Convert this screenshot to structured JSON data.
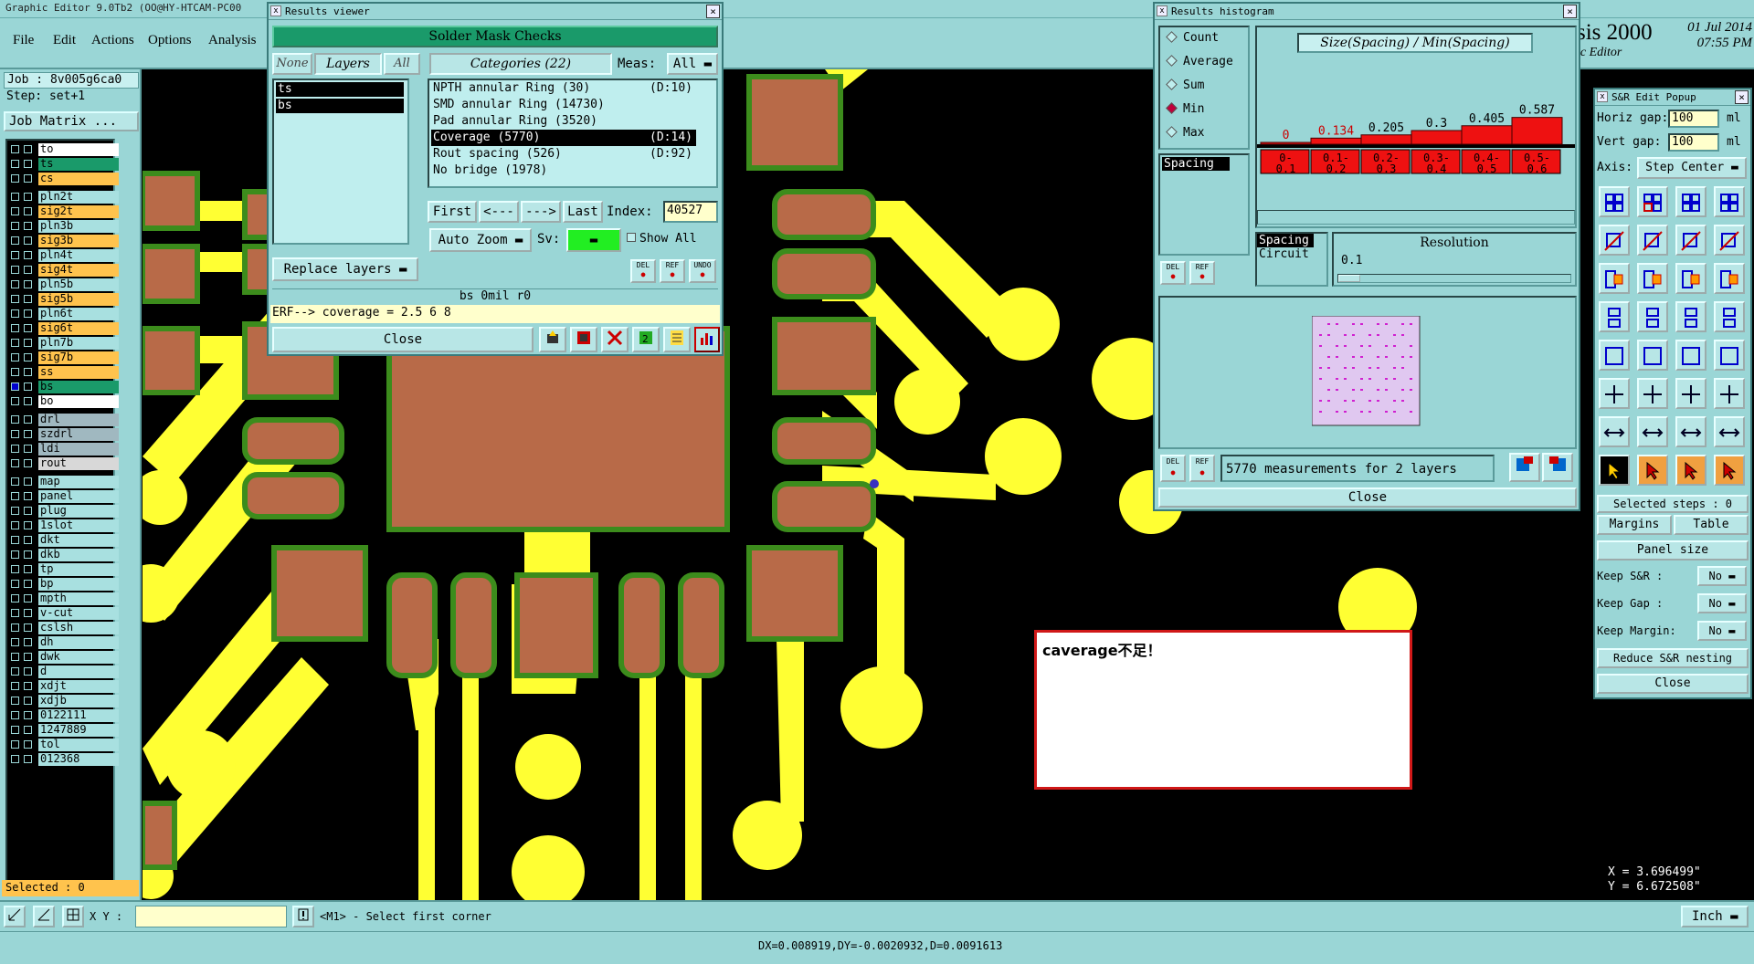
{
  "window": {
    "title": "Graphic Editor 9.0Tb2  (OO@HY-HTCAM-PC00"
  },
  "menu": {
    "items": [
      "File",
      "Edit",
      "Actions",
      "Options",
      "Analysis"
    ]
  },
  "brand": {
    "name": "sis 2000",
    "subtitle": "ic Editor",
    "date": "01 Jul 2014",
    "time": "07:55 PM"
  },
  "left": {
    "job": "Job : 8v005g6ca0",
    "step": "Step: set+1",
    "job_matrix": "Job Matrix ...",
    "selected": "Selected : 0",
    "layers": [
      {
        "name": "to",
        "color": "#ffffff",
        "checked": false
      },
      {
        "name": "ts",
        "color": "#1a9a6a",
        "checked": false
      },
      {
        "name": "cs",
        "color": "#ffc34d",
        "checked": false
      },
      {
        "name": "pln2t",
        "color": "#a8e0e0",
        "checked": false
      },
      {
        "name": "sig2t",
        "color": "#ffc34d",
        "checked": false
      },
      {
        "name": "pln3b",
        "color": "#a8e0e0",
        "checked": false
      },
      {
        "name": "sig3b",
        "color": "#ffc34d",
        "checked": false
      },
      {
        "name": "pln4t",
        "color": "#a8e0e0",
        "checked": false
      },
      {
        "name": "sig4t",
        "color": "#ffc34d",
        "checked": false
      },
      {
        "name": "pln5b",
        "color": "#a8e0e0",
        "checked": false
      },
      {
        "name": "sig5b",
        "color": "#ffc34d",
        "checked": false
      },
      {
        "name": "pln6t",
        "color": "#a8e0e0",
        "checked": false
      },
      {
        "name": "sig6t",
        "color": "#ffc34d",
        "checked": false
      },
      {
        "name": "pln7b",
        "color": "#a8e0e0",
        "checked": false
      },
      {
        "name": "sig7b",
        "color": "#ffc34d",
        "checked": false
      },
      {
        "name": "ss",
        "color": "#ffc34d",
        "checked": false
      },
      {
        "name": "bs",
        "color": "#1a9a6a",
        "checked": true
      },
      {
        "name": "bo",
        "color": "#ffffff",
        "checked": false
      },
      {
        "name": "drl",
        "color": "#a0b8c0",
        "checked": false
      },
      {
        "name": "szdrl",
        "color": "#a0b8c0",
        "checked": false
      },
      {
        "name": "ldi",
        "color": "#a0b8c0",
        "checked": false
      },
      {
        "name": "rout",
        "color": "#d8d8d8",
        "checked": false
      },
      {
        "name": "map",
        "color": "#a8e0e0",
        "checked": false
      },
      {
        "name": "panel",
        "color": "#a8e0e0",
        "checked": false
      },
      {
        "name": "plug",
        "color": "#a8e0e0",
        "checked": false
      },
      {
        "name": "1slot",
        "color": "#a8e0e0",
        "checked": false
      },
      {
        "name": "dkt",
        "color": "#a8e0e0",
        "checked": false
      },
      {
        "name": "dkb",
        "color": "#a8e0e0",
        "checked": false
      },
      {
        "name": "tp",
        "color": "#a8e0e0",
        "checked": false
      },
      {
        "name": "bp",
        "color": "#a8e0e0",
        "checked": false
      },
      {
        "name": "mpth",
        "color": "#a8e0e0",
        "checked": false
      },
      {
        "name": "v-cut",
        "color": "#a8e0e0",
        "checked": false
      },
      {
        "name": "cslsh",
        "color": "#a8e0e0",
        "checked": false
      },
      {
        "name": "dh",
        "color": "#a8e0e0",
        "checked": false
      },
      {
        "name": "dwk",
        "color": "#a8e0e0",
        "checked": false
      },
      {
        "name": "d",
        "color": "#a8e0e0",
        "checked": false
      },
      {
        "name": "xdjt",
        "color": "#a8e0e0",
        "checked": false
      },
      {
        "name": "xdjb",
        "color": "#a8e0e0",
        "checked": false
      },
      {
        "name": "0122111",
        "color": "#a8e0e0",
        "checked": false
      },
      {
        "name": "1247889",
        "color": "#a8e0e0",
        "checked": false
      },
      {
        "name": "tol",
        "color": "#a8e0e0",
        "checked": false
      },
      {
        "name": "012368",
        "color": "#a8e0e0",
        "checked": false
      }
    ]
  },
  "results_viewer": {
    "title": "Results viewer",
    "header": "Solder Mask Checks",
    "tabs": [
      "None",
      "Layers",
      "All"
    ],
    "categories_label": "Categories (22)",
    "meas_label": "Meas:",
    "meas_value": "All",
    "layers": [
      "ts",
      "bs"
    ],
    "categories": [
      {
        "name": "NPTH annular Ring (30)",
        "tag": "(D:10)",
        "selected": false
      },
      {
        "name": "SMD annular Ring (14730)",
        "tag": "",
        "selected": false
      },
      {
        "name": "Pad annular Ring (3520)",
        "tag": "",
        "selected": false
      },
      {
        "name": "Coverage (5770)",
        "tag": "(D:14)",
        "selected": true
      },
      {
        "name": "Rout spacing (526)",
        "tag": "(D:92)",
        "selected": false
      },
      {
        "name": "No bridge (1978)",
        "tag": "",
        "selected": false
      }
    ],
    "nav": {
      "first": "First",
      "prev": "<---",
      "next": "--->",
      "last": "Last",
      "index_label": "Index:",
      "index_value": "40527"
    },
    "auto_zoom": "Auto Zoom",
    "sv_label": "Sv:",
    "show_all": "Show All",
    "replace_layers": "Replace layers",
    "small_btns": [
      "DEL",
      "REF",
      "UNDO"
    ],
    "info_line": "bs 0mil  r0",
    "erf_line": "ERF--> coverage = 2.5 6 8",
    "close": "Close"
  },
  "histogram": {
    "title": "Results histogram",
    "options": [
      {
        "label": "Count",
        "on": false
      },
      {
        "label": "Average",
        "on": false
      },
      {
        "label": "Sum",
        "on": false
      },
      {
        "label": "Min",
        "on": true
      },
      {
        "label": "Max",
        "on": false
      }
    ],
    "formula": "Size(Spacing) / Min(Spacing)",
    "bins": [
      {
        "range": "0-\n0.1",
        "value": "0"
      },
      {
        "range": "0.1-\n0.2",
        "value": "0.134"
      },
      {
        "range": "0.2-\n0.3",
        "value": "0.205"
      },
      {
        "range": "0.3-\n0.4",
        "value": "0.3"
      },
      {
        "range": "0.4-\n0.5",
        "value": "0.405"
      },
      {
        "range": "0.5-\n0.6",
        "value": "0.587"
      }
    ],
    "list_item": "Spacing",
    "types": [
      "Spacing",
      "Circuit"
    ],
    "resolution_label": "Resolution",
    "resolution_value": "0.1",
    "summary": "5770 measurements for 2 layers",
    "small_btns": [
      "DEL",
      "REF"
    ],
    "close": "Close"
  },
  "sr_popup": {
    "title": "S&R Edit Popup",
    "horiz_label": "Horiz gap:",
    "horiz_value": "100",
    "vert_label": "Vert  gap:",
    "vert_value": "100",
    "unit": "ml",
    "axis_label": "Axis:",
    "axis_value": "Step Center",
    "selected_steps": "Selected steps : 0",
    "margins": "Margins",
    "table": "Table",
    "panel_size": "Panel size",
    "keep_sr": "Keep S&R  :",
    "keep_gap": "Keep Gap   :",
    "keep_margin": "Keep Margin:",
    "no": "No",
    "reduce": "Reduce S&R nesting",
    "close": "Close"
  },
  "bottom": {
    "xy_label": "X Y :",
    "status": "<M1> - Select first corner",
    "units": "Inch",
    "delta": "DX=0.008919,DY=-0.0020932,D=0.0091613",
    "coord_x": "X = 3.696499\"",
    "coord_y": "Y = 6.672508\""
  },
  "note": {
    "text": "caverage不足！"
  }
}
